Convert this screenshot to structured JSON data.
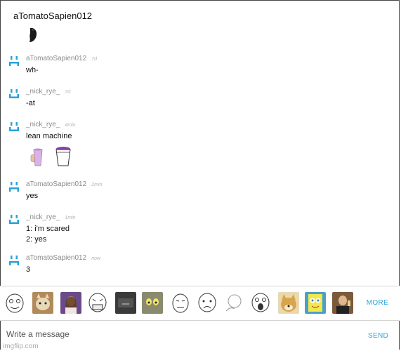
{
  "chat": {
    "title": "aTomatoSapien012"
  },
  "messages": [
    {
      "user": "aTomatoSapien012",
      "time": "7d",
      "text": "wh-"
    },
    {
      "user": "_nick_rye_",
      "time": "7d",
      "text": "-at"
    },
    {
      "user": "_nick_rye_",
      "time": "4min",
      "text": "lean machine"
    },
    {
      "user": "aTomatoSapien012",
      "time": "2min",
      "text": "yes"
    },
    {
      "user": "_nick_rye_",
      "time": "1min",
      "text": "1: i'm scared\n2: yes"
    },
    {
      "user": "aTomatoSapien012",
      "time": "now",
      "text": "3"
    }
  ],
  "stickers": {
    "more_label": "MORE"
  },
  "composer": {
    "placeholder": "Write a message",
    "send_label": "SEND"
  },
  "watermark": "imgflip.com",
  "colors": {
    "accent": "#2aa3d9",
    "avatar_icon": "#2aa3d9"
  }
}
